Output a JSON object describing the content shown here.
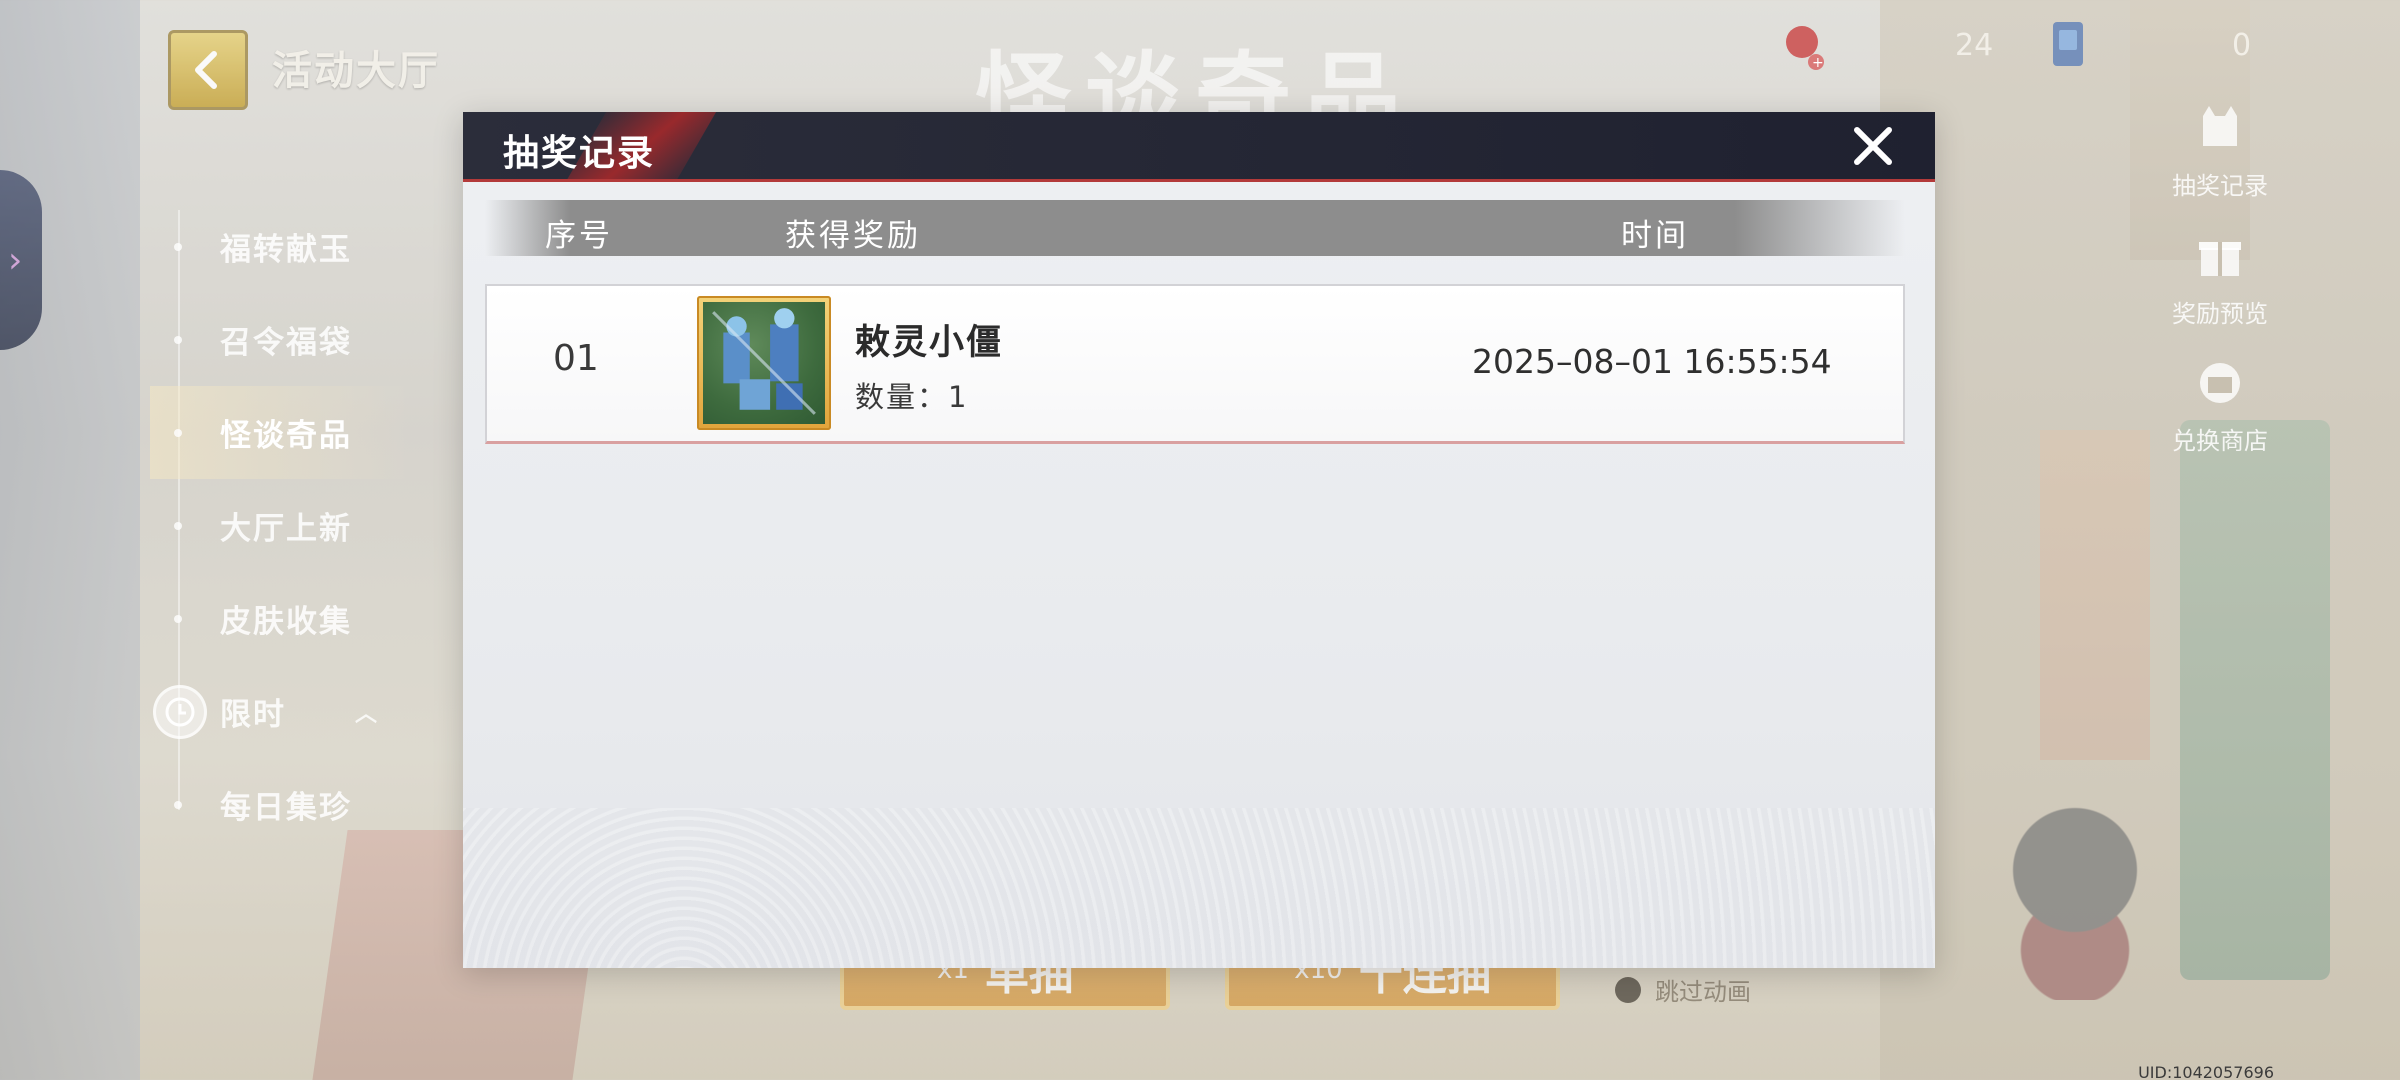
{
  "hall": {
    "title": "活动大厅"
  },
  "event_title": "怪谈奇品",
  "currencies": [
    {
      "value": "24"
    },
    {
      "value": "0"
    }
  ],
  "menu": {
    "items": [
      {
        "label": "福转献玉",
        "active": false
      },
      {
        "label": "召令福袋",
        "active": false
      },
      {
        "label": "怪谈奇品",
        "active": true
      },
      {
        "label": "大厅上新",
        "active": false
      },
      {
        "label": "皮肤收集",
        "active": false
      },
      {
        "label": "限时",
        "active": false
      },
      {
        "label": "每日集珍",
        "active": false
      }
    ]
  },
  "right_buttons": [
    {
      "label": "抽奖记录",
      "icon": "cat-bag-icon"
    },
    {
      "label": "奖励预览",
      "icon": "gift-icon"
    },
    {
      "label": "兑换商店",
      "icon": "shop-gift-icon"
    }
  ],
  "bottom": {
    "single": {
      "qty": "x1",
      "label": "单抽"
    },
    "ten": {
      "qty": "x10",
      "label": "十连抽"
    },
    "skip_label": "跳过动画",
    "uid": "UID:1042057696"
  },
  "modal": {
    "title": "抽奖记录",
    "columns": {
      "index": "序号",
      "reward": "获得奖励",
      "time": "时间"
    },
    "records": [
      {
        "index": "01",
        "name": "敕灵小僵",
        "qty": "数量：1",
        "time": "2025–08–01 16:55:54"
      }
    ]
  },
  "colors": {
    "header_bg": "#2b2d3a",
    "accent_red": "#b33a3a",
    "item_frame": "#e1a43b"
  }
}
